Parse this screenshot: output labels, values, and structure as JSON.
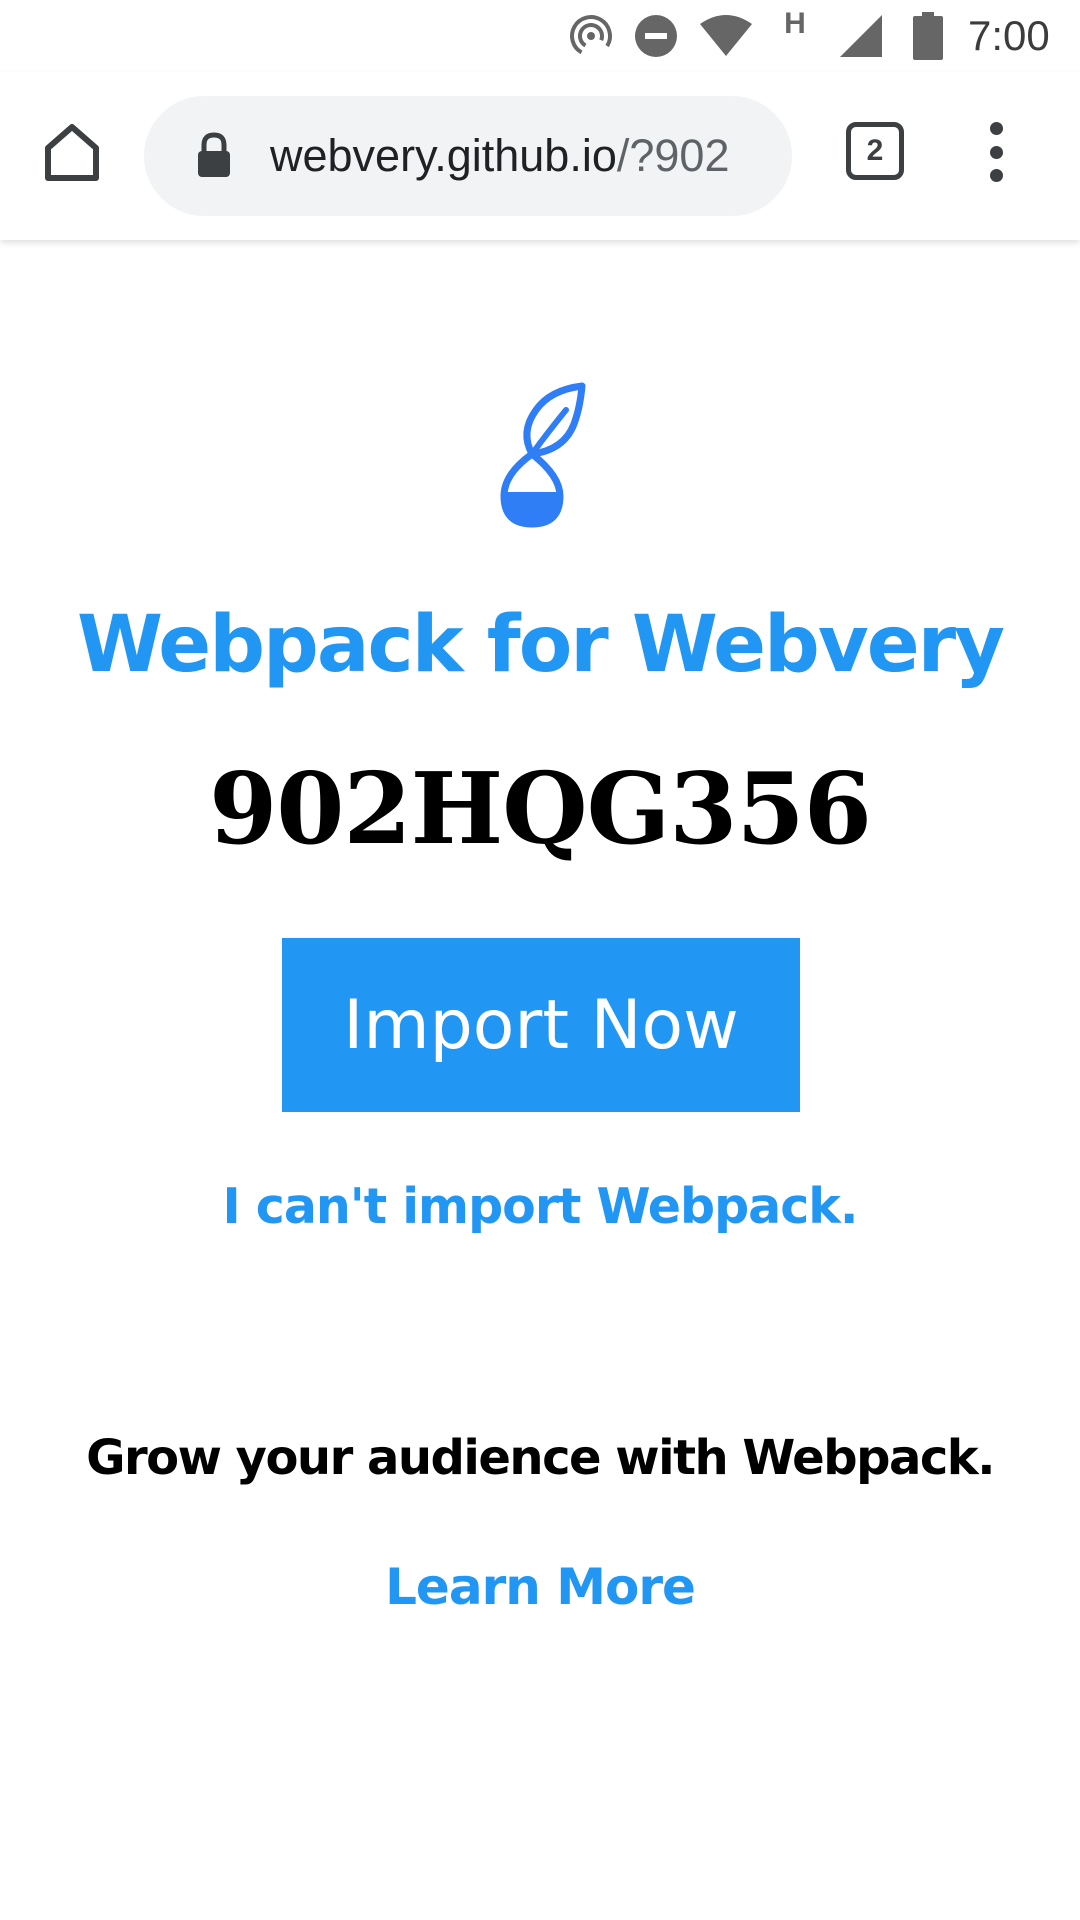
{
  "status_bar": {
    "time": "7:00",
    "network_type": "H",
    "icons": [
      "hotspot-icon",
      "do-not-disturb-icon",
      "wifi-icon",
      "cell-signal-icon",
      "battery-icon"
    ]
  },
  "browser": {
    "url_host": "webvery.github.io",
    "url_rest": "/?902",
    "tab_count": "2",
    "icons": [
      "home-icon",
      "lock-icon",
      "tabs-icon",
      "more-vert-icon"
    ]
  },
  "page": {
    "logo_icon": "leaf-hourglass-logo-icon",
    "title": "Webpack for Webvery",
    "code": "902HQG356",
    "import_button_label": "Import Now",
    "cant_import_link": "I can't import Webpack.",
    "grow_text": "Grow your audience with Webpack.",
    "learn_more_link": "Learn More"
  },
  "colors": {
    "accent": "#2196f3",
    "icon_dark": "#3c4043",
    "url_bar_bg": "#f1f3f4"
  }
}
